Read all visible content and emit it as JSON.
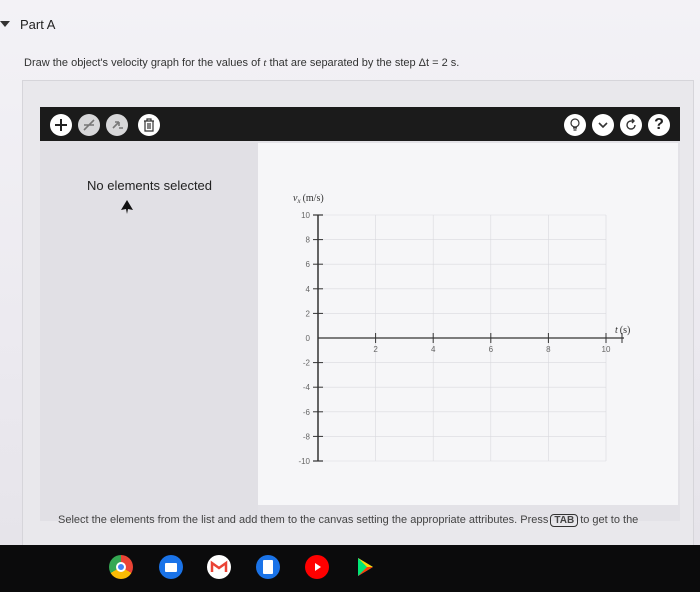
{
  "part": {
    "title": "Part A"
  },
  "instruction": {
    "prefix": "Draw the object's velocity graph for the values of ",
    "var_t": "t",
    "middle": " that are separated by the step ",
    "step": "Δt = 2 s."
  },
  "toolbar": {
    "left_tools": [
      "add-icon",
      "delete-icon",
      "move-icon",
      "trash-icon"
    ],
    "right_tools": [
      "hint-icon",
      "chevron-down-icon",
      "reset-icon",
      "help-icon"
    ],
    "help_label": "?"
  },
  "panel": {
    "status": "No elements selected"
  },
  "graph": {
    "y_axis_label": "vx (m/s)",
    "y_axis_var": "v",
    "y_axis_sub": "x",
    "y_axis_unit": "(m/s)",
    "x_axis_label": "t (s)",
    "x_axis_var": "t",
    "x_axis_unit": "(s)",
    "x_ticks": [
      "2",
      "4",
      "6",
      "8",
      "10"
    ],
    "y_ticks": [
      "10",
      "8",
      "6",
      "4",
      "2",
      "0",
      "-2",
      "-4",
      "-6",
      "-8",
      "-10"
    ]
  },
  "chart_data": {
    "type": "line",
    "title": "",
    "xlabel": "t (s)",
    "ylabel": "vx (m/s)",
    "xlim": [
      0,
      10
    ],
    "ylim": [
      -10,
      10
    ],
    "x_ticks": [
      2,
      4,
      6,
      8,
      10
    ],
    "y_ticks": [
      -10,
      -8,
      -6,
      -4,
      -2,
      0,
      2,
      4,
      6,
      8,
      10
    ],
    "series": [],
    "grid": true
  },
  "footer": {
    "text_before": "Select the elements from the list and add them to the canvas setting the appropriate attributes. Press",
    "tab_key": "TAB",
    "text_after": "to get to the"
  },
  "taskbar": {
    "apps": [
      "chrome-icon",
      "files-icon",
      "gmail-icon",
      "docs-icon",
      "youtube-icon",
      "play-store-icon"
    ]
  },
  "colors": {
    "toolbar_bg": "#1b1b1b",
    "tool_button": "#ffffff",
    "axis": "#333333",
    "grid": "#d9d9de"
  }
}
